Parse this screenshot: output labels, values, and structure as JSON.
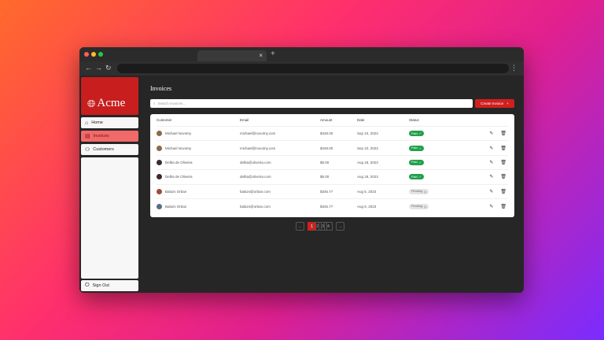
{
  "browser": {
    "tab_close": "×",
    "new_tab": "+",
    "back": "←",
    "forward": "→",
    "reload": "↻",
    "menu": "⋮"
  },
  "brand": {
    "name": "Acme",
    "icon": "globe-icon"
  },
  "sidebar": {
    "items": [
      {
        "label": "Home",
        "icon": "home-icon",
        "glyph": "⌂"
      },
      {
        "label": "Invoices",
        "icon": "invoice-icon",
        "glyph": "▤"
      },
      {
        "label": "Customers",
        "icon": "users-icon",
        "glyph": "⚇"
      }
    ],
    "signout": {
      "label": "Sign Out",
      "glyph": "⏻"
    }
  },
  "main": {
    "title": "Invoices",
    "search_placeholder": "Search invoices...",
    "create_label": "Create Invoice",
    "create_glyph": "+"
  },
  "table": {
    "headers": [
      "Customer",
      "Email",
      "Amount",
      "Date",
      "Status"
    ],
    "rows": [
      {
        "customer": "Michael Novotny",
        "email": "michael@novotny.com",
        "amount": "$448.00",
        "date": "Sep 10, 2023",
        "status": "Paid",
        "avatar_color": "#8a6a4a"
      },
      {
        "customer": "Michael Novotny",
        "email": "michael@novotny.com",
        "amount": "$448.00",
        "date": "Sep 10, 2023",
        "status": "Paid",
        "avatar_color": "#8a6a4a"
      },
      {
        "customer": "Delba de Oliveira",
        "email": "delba@oliveira.com",
        "amount": "$5.00",
        "date": "Aug 18, 2023",
        "status": "Paid",
        "avatar_color": "#3b2b2b"
      },
      {
        "customer": "Delba de Oliveira",
        "email": "delba@oliveira.com",
        "amount": "$5.00",
        "date": "Aug 18, 2023",
        "status": "Paid",
        "avatar_color": "#3b2b2b"
      },
      {
        "customer": "Balazs Orban",
        "email": "balazs@orban.com",
        "amount": "$345.77",
        "date": "Aug 5, 2023",
        "status": "Pending",
        "avatar_color": "#a04a3a"
      },
      {
        "customer": "Balazs Orban",
        "email": "balazs@orban.com",
        "amount": "$345.77",
        "date": "Aug 5, 2023",
        "status": "Pending",
        "avatar_color": "#5a6a8a"
      }
    ],
    "paid_glyph": "✓",
    "pending_glyph": "◷",
    "edit_glyph": "✎",
    "delete_glyph": "🗑"
  },
  "pagination": {
    "prev": "←",
    "pages": [
      "1",
      "2",
      "3",
      "4"
    ],
    "active_page": "1",
    "next": "→"
  },
  "colors": {
    "accent": "#d11f1f",
    "paid": "#22a04b"
  }
}
